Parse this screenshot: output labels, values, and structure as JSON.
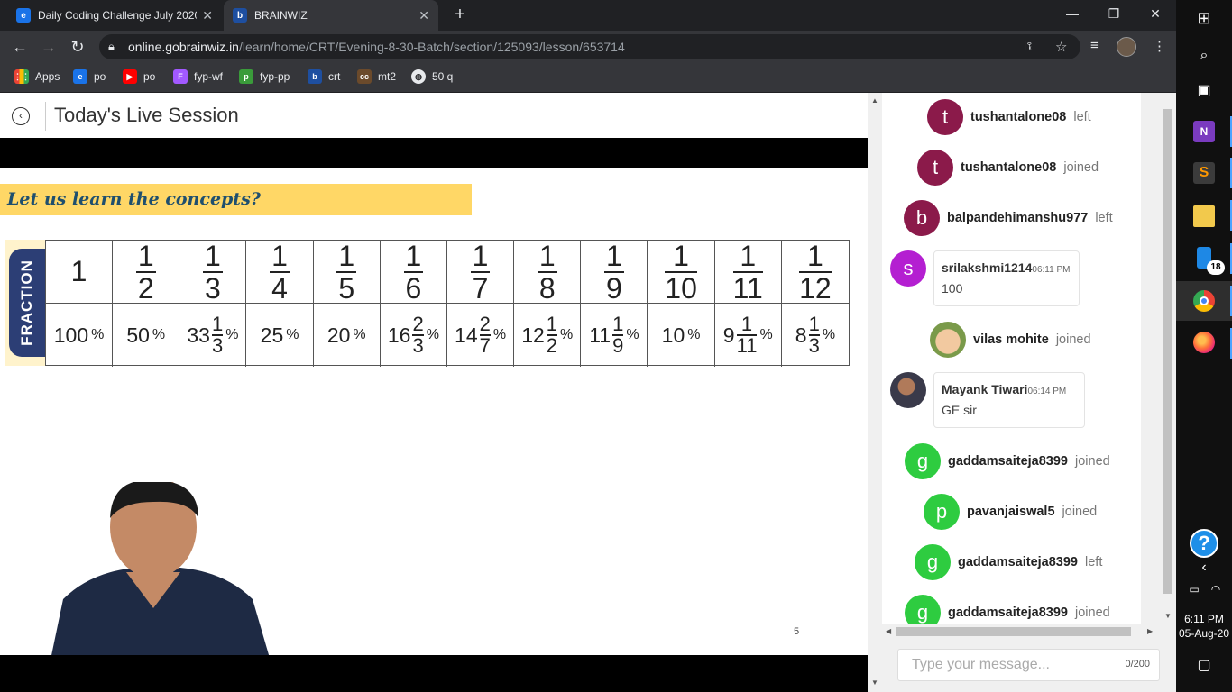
{
  "browser": {
    "tabs": [
      {
        "title": "Daily Coding Challenge July 2020",
        "favicon": "coding-challenge-favicon",
        "active": false
      },
      {
        "title": "BRAINWIZ",
        "favicon": "brainwiz-favicon",
        "active": true
      }
    ],
    "url_host": "online.gobrainwiz.in",
    "url_path": "/learn/home/CRT/Evening-8-30-Batch/section/125093/lesson/653714",
    "bookmarks": [
      {
        "label": "Apps",
        "icon": "apps-grid-icon"
      },
      {
        "label": "po",
        "icon": "edge-icon"
      },
      {
        "label": "po",
        "icon": "youtube-icon"
      },
      {
        "label": "fyp-wf",
        "icon": "figma-icon"
      },
      {
        "label": "fyp-pp",
        "icon": "image-icon"
      },
      {
        "label": "crt",
        "icon": "brainwiz-icon"
      },
      {
        "label": "mt2",
        "icon": "cc-icon"
      },
      {
        "label": "50 q",
        "icon": "globe-icon"
      }
    ]
  },
  "page": {
    "title": "Today's Live Session"
  },
  "slide": {
    "banner": "Let us learn the concepts?",
    "side_label": "FRACTION",
    "page_number": "5",
    "fractions": [
      {
        "whole": "1"
      },
      {
        "num": "1",
        "den": "2"
      },
      {
        "num": "1",
        "den": "3"
      },
      {
        "num": "1",
        "den": "4"
      },
      {
        "num": "1",
        "den": "5"
      },
      {
        "num": "1",
        "den": "6"
      },
      {
        "num": "1",
        "den": "7"
      },
      {
        "num": "1",
        "den": "8"
      },
      {
        "num": "1",
        "den": "9"
      },
      {
        "num": "1",
        "den": "10"
      },
      {
        "num": "1",
        "den": "11"
      },
      {
        "num": "1",
        "den": "12"
      }
    ],
    "percentages": [
      {
        "int": "100",
        "n": "",
        "d": ""
      },
      {
        "int": "50",
        "n": "",
        "d": ""
      },
      {
        "int": "33",
        "n": "1",
        "d": "3"
      },
      {
        "int": "25",
        "n": "",
        "d": ""
      },
      {
        "int": "20",
        "n": "",
        "d": ""
      },
      {
        "int": "16",
        "n": "2",
        "d": "3"
      },
      {
        "int": "14",
        "n": "2",
        "d": "7"
      },
      {
        "int": "12",
        "n": "1",
        "d": "2"
      },
      {
        "int": "11",
        "n": "1",
        "d": "9"
      },
      {
        "int": "10",
        "n": "",
        "d": ""
      },
      {
        "int": "9",
        "n": "1",
        "d": "11"
      },
      {
        "int": "8",
        "n": "1",
        "d": "3"
      }
    ],
    "percent_sign": "%"
  },
  "chat": {
    "events": [
      {
        "initial": "t",
        "color": "#8b1a4a",
        "user": "tushantalone08",
        "status": "left"
      },
      {
        "initial": "t",
        "color": "#8b1a4a",
        "user": "tushantalone08",
        "status": "joined"
      },
      {
        "initial": "b",
        "color": "#8b1a4a",
        "user": "balpandehimanshu977",
        "status": "left"
      },
      {
        "initial": "",
        "color": "#c9b08a",
        "user": "vilas mohite",
        "status": "joined"
      },
      {
        "initial": "g",
        "color": "#2ecc40",
        "user": "gaddamsaiteja8399",
        "status": "joined"
      },
      {
        "initial": "p",
        "color": "#2ecc40",
        "user": "pavanjaiswal5",
        "status": "joined"
      },
      {
        "initial": "g",
        "color": "#2ecc40",
        "user": "gaddamsaiteja8399",
        "status": "left"
      },
      {
        "initial": "g",
        "color": "#2ecc40",
        "user": "gaddamsaiteja8399",
        "status": "joined"
      }
    ],
    "messages": [
      {
        "initial": "s",
        "color": "#b41fd1",
        "user": "srilakshmi1214",
        "time": "06:11 PM",
        "text": "100"
      },
      {
        "initial": "",
        "color": "#5a4a3a",
        "user": "Mayank Tiwari",
        "time": "06:14 PM",
        "text": "GE sir"
      }
    ],
    "input_placeholder": "Type your message...",
    "counter": "0/200"
  },
  "taskbar": {
    "time": "6:11 PM",
    "date": "05-Aug-20",
    "badge": "18",
    "help": "?"
  }
}
